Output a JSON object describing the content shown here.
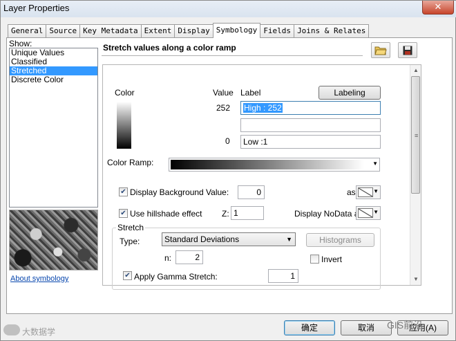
{
  "window": {
    "title": "Layer Properties",
    "close_glyph": "✕"
  },
  "tabs": [
    {
      "label": "General"
    },
    {
      "label": "Source"
    },
    {
      "label": "Key Metadata"
    },
    {
      "label": "Extent"
    },
    {
      "label": "Display"
    },
    {
      "label": "Symbology",
      "active": true
    },
    {
      "label": "Fields"
    },
    {
      "label": "Joins & Relates"
    }
  ],
  "show": {
    "label": "Show:",
    "items": [
      {
        "label": "Unique Values"
      },
      {
        "label": "Classified"
      },
      {
        "label": "Stretched",
        "selected": true
      },
      {
        "label": "Discrete Color"
      }
    ]
  },
  "about_link": "About symbology",
  "heading": "Stretch values along a color ramp",
  "toolbar": {
    "open_icon": "folder-open-icon",
    "save_icon": "save-icon"
  },
  "table": {
    "color_header": "Color",
    "value_header": "Value",
    "label_header": "Label",
    "labeling_button": "Labeling",
    "high_value": "252",
    "high_label": "High : 252",
    "mid_label": "",
    "low_value": "0",
    "low_label": "Low :1"
  },
  "color_ramp": {
    "label": "Color Ramp:"
  },
  "background": {
    "checked": true,
    "label": "Display Background Value:",
    "value": "0",
    "as_label": "as"
  },
  "hillshade": {
    "checked": true,
    "label": "Use hillshade effect",
    "z_label": "Z:",
    "z_value": "1",
    "nodata_label": "Display NoData as"
  },
  "stretch": {
    "group_label": "Stretch",
    "type_label": "Type:",
    "type_value": "Standard Deviations",
    "histograms_button": "Histograms",
    "n_label": "n:",
    "n_value": "2",
    "invert_checked": false,
    "invert_label": "Invert",
    "gamma_checked": true,
    "gamma_label": "Apply Gamma Stretch:",
    "gamma_value": "1"
  },
  "buttons": {
    "ok": "确定",
    "cancel": "取消",
    "apply": "应用(A)"
  },
  "watermarks": {
    "left": "大数据学",
    "right": "GIS前沿"
  }
}
